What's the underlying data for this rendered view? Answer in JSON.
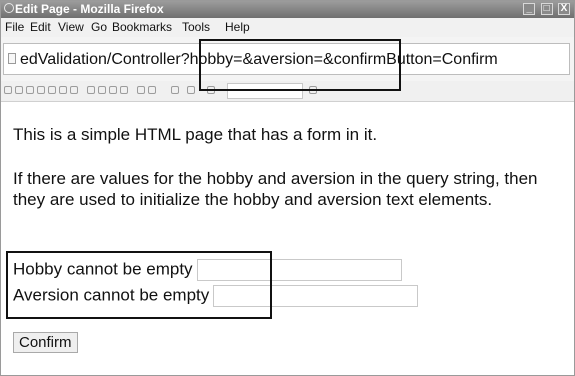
{
  "window": {
    "title": "Edit Page - Mozilla Firefox",
    "controls": [
      "_",
      "□",
      "X"
    ]
  },
  "menu": [
    "File",
    "Edit",
    "View",
    "Go",
    "Bookmarks",
    "Tools",
    "Help"
  ],
  "address_bar": {
    "url_visible": "edValidation/Controller?hobby=&aversion=&confirmButton=Confirm"
  },
  "page": {
    "intro": "This is a simple HTML page that has a form in it.",
    "description": "If there are values for the hobby and aversion in the query string, then they are used to initialize the hobby and aversion text elements.",
    "hobby_error": "Hobby cannot be empty",
    "hobby_value": "",
    "aversion_error": "Aversion cannot be empty",
    "aversion_value": "",
    "confirm_label": "Confirm"
  }
}
